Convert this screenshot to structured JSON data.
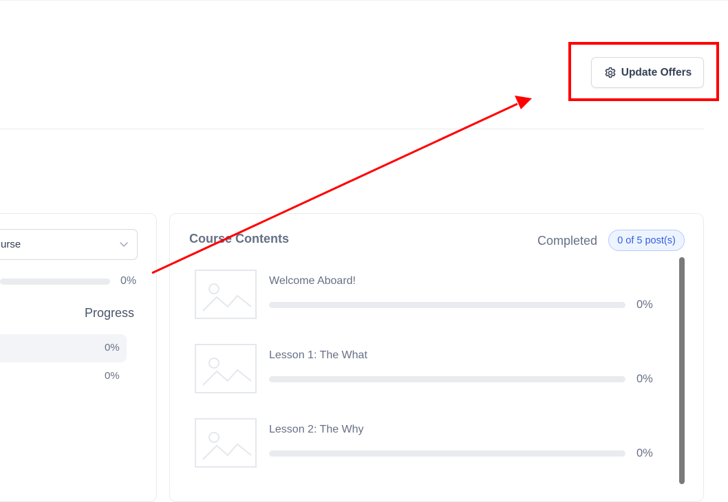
{
  "header": {
    "update_button_label": "Update Offers",
    "update_button_icon": "gear-icon"
  },
  "left_panel": {
    "course_select_value": "urse",
    "overall_progress_pct": "0%",
    "overall_progress_value": 0,
    "progress_heading": "Progress",
    "rows": [
      {
        "pct": "0%"
      },
      {
        "pct": "0%"
      }
    ]
  },
  "course_contents": {
    "title": "Course Contents",
    "completed_label": "Completed",
    "completed_badge": "0 of 5 post(s)",
    "lessons": [
      {
        "title": "Welcome Aboard!",
        "pct": "0%",
        "progress_value": 0
      },
      {
        "title": "Lesson 1: The What",
        "pct": "0%",
        "progress_value": 0
      },
      {
        "title": "Lesson 2: The Why",
        "pct": "0%",
        "progress_value": 0
      }
    ]
  },
  "annotation": {
    "color": "#ff0000"
  }
}
